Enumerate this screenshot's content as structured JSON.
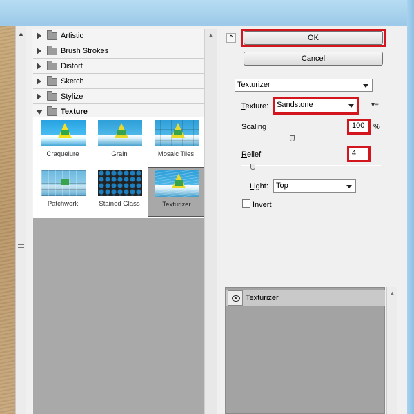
{
  "categories": [
    {
      "label": "Artistic",
      "expanded": false
    },
    {
      "label": "Brush Strokes",
      "expanded": false
    },
    {
      "label": "Distort",
      "expanded": false
    },
    {
      "label": "Sketch",
      "expanded": false
    },
    {
      "label": "Stylize",
      "expanded": false
    },
    {
      "label": "Texture",
      "expanded": true
    }
  ],
  "texture_filters": [
    {
      "label": "Craquelure",
      "selected": false
    },
    {
      "label": "Grain",
      "selected": false
    },
    {
      "label": "Mosaic Tiles",
      "selected": false
    },
    {
      "label": "Patchwork",
      "selected": false
    },
    {
      "label": "Stained Glass",
      "selected": false
    },
    {
      "label": "Texturizer",
      "selected": true
    }
  ],
  "buttons": {
    "ok": "OK",
    "cancel": "Cancel"
  },
  "settings": {
    "filter_select": "Texturizer",
    "texture_prefix": "T",
    "texture_suffix": "exture:",
    "texture_value": "Sandstone",
    "scaling_prefix": "S",
    "scaling_suffix": "caling",
    "scaling_value": "100",
    "scaling_unit": "%",
    "scaling_fraction": 0.36,
    "relief_prefix": "R",
    "relief_suffix": "elief",
    "relief_value": "4",
    "relief_fraction": 0.08,
    "light_prefix": "L",
    "light_suffix": "ight:",
    "light_value": "Top",
    "invert_prefix": "I",
    "invert_suffix": "nvert",
    "invert_checked": false
  },
  "layers": {
    "items": [
      "Texturizer"
    ]
  },
  "colors": {
    "highlight": "#d3161e"
  }
}
